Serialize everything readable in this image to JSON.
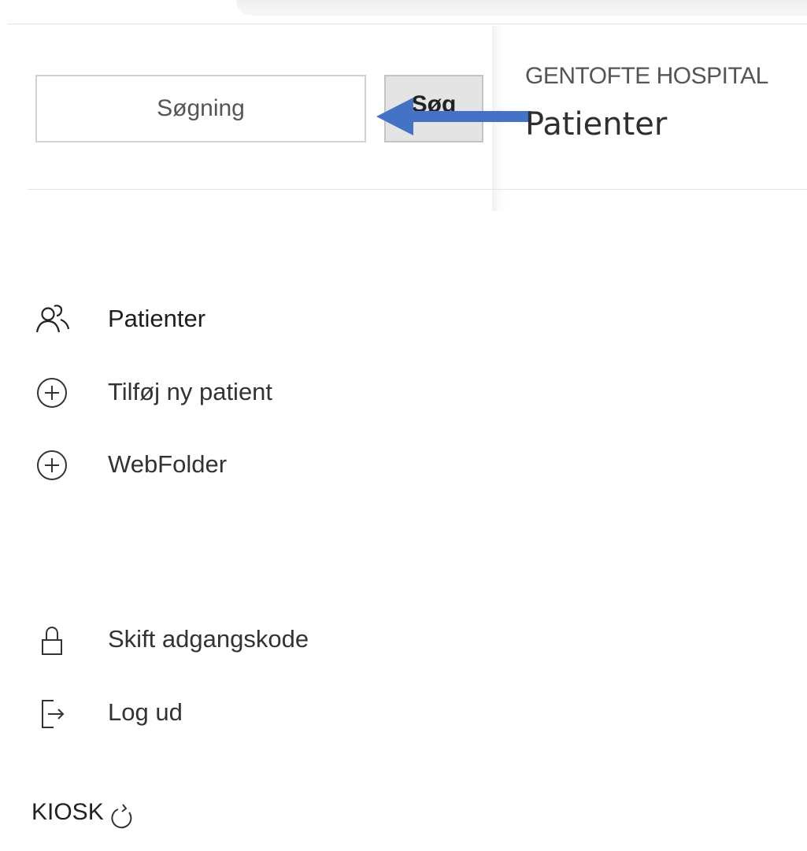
{
  "search": {
    "placeholder": "Søgning",
    "value": "",
    "button_label": "Søg"
  },
  "header": {
    "subtitle": "GENTOFTE HOSPITAL",
    "title": "Patienter"
  },
  "nav": {
    "primary": [
      {
        "label": "Patienter",
        "icon": "users-icon"
      },
      {
        "label": "Tilføj ny patient",
        "icon": "plus-circle-icon"
      },
      {
        "label": "WebFolder",
        "icon": "plus-circle-icon"
      }
    ],
    "secondary": [
      {
        "label": "Skift adgangskode",
        "icon": "lock-icon"
      },
      {
        "label": "Log ud",
        "icon": "logout-icon"
      }
    ]
  },
  "kiosk": {
    "label": "KIOSK",
    "icon": "refresh-icon"
  },
  "colors": {
    "annotation_arrow": "#4472c4",
    "button_bg": "#e4e4e4",
    "divider": "#e3e3e3"
  }
}
